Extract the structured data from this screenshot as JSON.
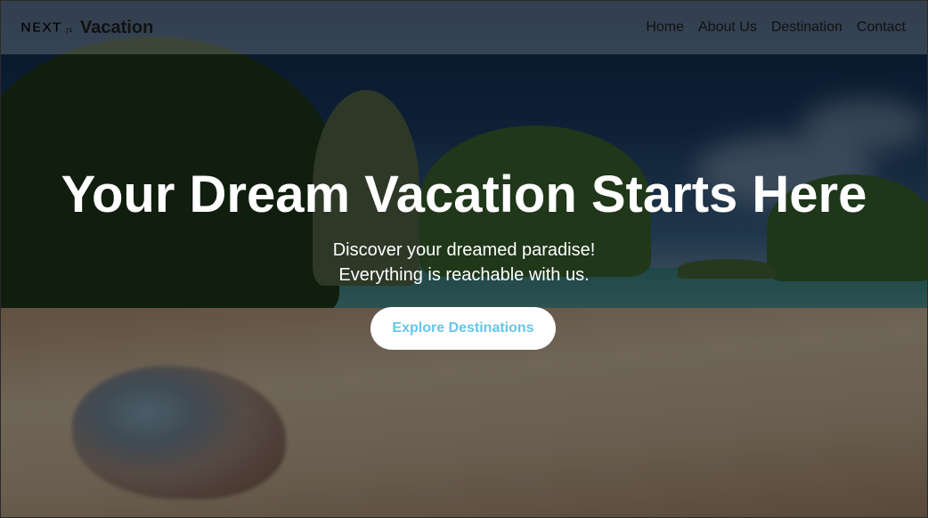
{
  "navbar": {
    "logo_text": "NEXT",
    "logo_subtext": ".JS",
    "brand_name": "Vacation",
    "links": [
      {
        "label": "Home"
      },
      {
        "label": "About Us"
      },
      {
        "label": "Destination"
      },
      {
        "label": "Contact"
      }
    ]
  },
  "hero": {
    "title": "Your Dream Vacation Starts Here",
    "subtitle_line1": "Discover your dreamed paradise!",
    "subtitle_line2": "Everything is reachable with us.",
    "cta_label": "Explore Destinations"
  },
  "colors": {
    "cta_text": "#66c6ea",
    "cta_background": "#ffffff",
    "overlay": "rgba(0,0,0,0.48)"
  }
}
